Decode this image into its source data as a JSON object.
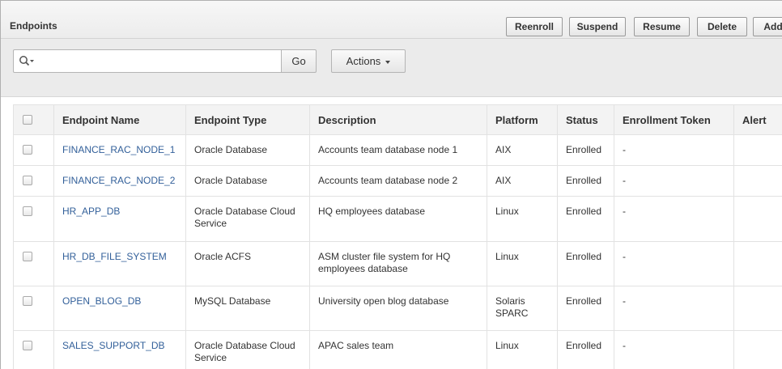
{
  "region": {
    "title": "Endpoints",
    "buttons": [
      "Reenroll",
      "Suspend",
      "Resume",
      "Delete",
      "Add"
    ]
  },
  "toolbar": {
    "search_value": "",
    "go_label": "Go",
    "actions_label": "Actions"
  },
  "table": {
    "columns": [
      "Endpoint Name",
      "Endpoint Type",
      "Description",
      "Platform",
      "Status",
      "Enrollment Token",
      "Alert"
    ],
    "rows": [
      {
        "name": "FINANCE_RAC_NODE_1",
        "type": "Oracle Database",
        "description": "Accounts team database node 1",
        "platform": "AIX",
        "status": "Enrolled",
        "token": "-",
        "alert": ""
      },
      {
        "name": "FINANCE_RAC_NODE_2",
        "type": "Oracle Database",
        "description": "Accounts team database node 2",
        "platform": "AIX",
        "status": "Enrolled",
        "token": "-",
        "alert": ""
      },
      {
        "name": "HR_APP_DB",
        "type": "Oracle Database Cloud Service",
        "description": "HQ employees database",
        "platform": "Linux",
        "status": "Enrolled",
        "token": "-",
        "alert": ""
      },
      {
        "name": "HR_DB_FILE_SYSTEM",
        "type": "Oracle ACFS",
        "description": "ASM cluster file system for HQ employees database",
        "platform": "Linux",
        "status": "Enrolled",
        "token": "-",
        "alert": ""
      },
      {
        "name": "OPEN_BLOG_DB",
        "type": "MySQL Database",
        "description": "University open blog database",
        "platform": "Solaris SPARC",
        "status": "Enrolled",
        "token": "-",
        "alert": ""
      },
      {
        "name": "SALES_SUPPORT_DB",
        "type": "Oracle Database Cloud Service",
        "description": "APAC sales team",
        "platform": "Linux",
        "status": "Enrolled",
        "token": "-",
        "alert": ""
      }
    ]
  }
}
